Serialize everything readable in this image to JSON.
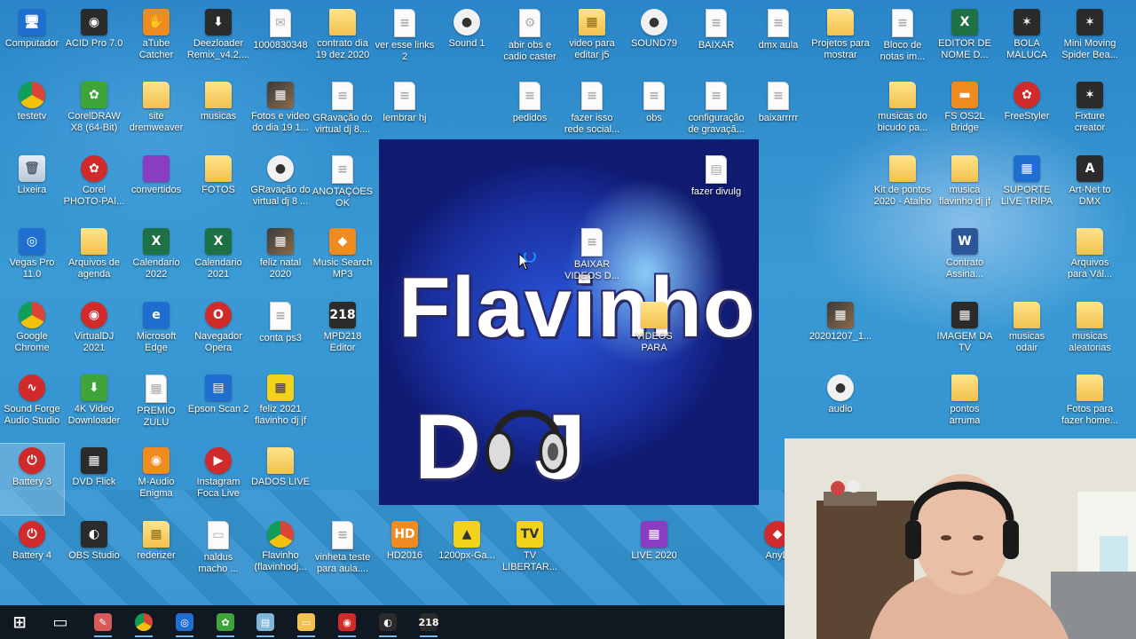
{
  "desktop": {
    "icons": [
      {
        "label": "Computador",
        "glyph": "🖥",
        "type": "blue"
      },
      {
        "label": "ACID Pro 7.0",
        "glyph": "◉",
        "type": "dark"
      },
      {
        "label": "aTube\nCatcher",
        "glyph": "✋",
        "type": "orange"
      },
      {
        "label": "Deezloader\nRemix_v4.2....",
        "glyph": "⬇",
        "type": "dark"
      },
      {
        "label": "1000830348",
        "glyph": "✉",
        "type": "file"
      },
      {
        "label": "contrato dia\n19 dez 2020",
        "glyph": "",
        "type": "folder"
      },
      {
        "label": "ver esse links\n2",
        "glyph": "≡",
        "type": "file"
      },
      {
        "label": "Sound 1",
        "glyph": "●",
        "type": "audio"
      },
      {
        "label": "abir obs e\ncadio caster",
        "glyph": "⚙",
        "type": "file"
      },
      {
        "label": "video para\neditar j5",
        "glyph": "▦",
        "type": "folder"
      },
      {
        "label": "SOUND79",
        "glyph": "●",
        "type": "audio"
      },
      {
        "label": "BAIXAR",
        "glyph": "≡",
        "type": "file"
      },
      {
        "label": "dmx aula",
        "glyph": "≡",
        "type": "file"
      },
      {
        "label": "Projetos para\nmostrar",
        "glyph": "",
        "type": "folder"
      },
      {
        "label": "Bloco de\nnotas im...",
        "glyph": "≡",
        "type": "file"
      },
      {
        "label": "EDITOR DE\nNOME D...",
        "glyph": "X",
        "type": "excel"
      },
      {
        "label": "BOLA\nMALUCA",
        "glyph": "✶",
        "type": "dark"
      },
      {
        "label": "Mini Moving\nSpider Bea...",
        "glyph": "✶",
        "type": "dark"
      },
      {
        "label": "testetv",
        "glyph": "",
        "type": "chrome"
      },
      {
        "label": "CorelDRAW\nX8 (64-Bit)",
        "glyph": "✿",
        "type": "green"
      },
      {
        "label": "site\ndremweaver",
        "glyph": "",
        "type": "folder"
      },
      {
        "label": "musicas",
        "glyph": "",
        "type": "folder"
      },
      {
        "label": "Fotos e video\ndo dia 19 1...",
        "glyph": "▦",
        "type": "img"
      },
      {
        "label": "GRavação do\nvirtual dj 8....",
        "glyph": "≡",
        "type": "file"
      },
      {
        "label": "lembrar hj",
        "glyph": "≡",
        "type": "file"
      },
      {
        "label": "pedidos",
        "glyph": "≡",
        "type": "file"
      },
      {
        "label": "fazer isso\nrede social...",
        "glyph": "≡",
        "type": "file"
      },
      {
        "label": "obs",
        "glyph": "≡",
        "type": "file"
      },
      {
        "label": "configuração\nde gravaçã...",
        "glyph": "≡",
        "type": "file"
      },
      {
        "label": "baixarrrrr",
        "glyph": "≡",
        "type": "file"
      },
      {
        "label": "musicas do\nbicudo pa...",
        "glyph": "",
        "type": "folder"
      },
      {
        "label": "FS OS2L\nBridge",
        "glyph": "▬",
        "type": "orange"
      },
      {
        "label": "FreeStyler",
        "glyph": "✿",
        "type": "red"
      },
      {
        "label": "Fixture\ncreator",
        "glyph": "✶",
        "type": "dark"
      },
      {
        "label": "Lixeira",
        "glyph": "🗑",
        "type": "bin"
      },
      {
        "label": "Corel\nPHOTO-PAI...",
        "glyph": "✿",
        "type": "red"
      },
      {
        "label": "convertidos",
        "glyph": "",
        "type": "purple"
      },
      {
        "label": "FOTOS",
        "glyph": "",
        "type": "folder"
      },
      {
        "label": "GRavação do\nvirtual dj 8 ...",
        "glyph": "●",
        "type": "audio"
      },
      {
        "label": "ANOTAÇÕES\nOK",
        "glyph": "≡",
        "type": "file"
      },
      {
        "label": "fazer divulg",
        "glyph": "▤",
        "type": "file"
      },
      {
        "label": "Kit de pontos\n2020 - Atalho",
        "glyph": "",
        "type": "folder"
      },
      {
        "label": "musica\nflavinho dj jf",
        "glyph": "",
        "type": "folder"
      },
      {
        "label": "SUPORTE\nLIVE TRIPA",
        "glyph": "▦",
        "type": "blue"
      },
      {
        "label": "Art-Net to\nDMX",
        "glyph": "A",
        "type": "dark"
      },
      {
        "label": "Vegas Pro\n11.0",
        "glyph": "◎",
        "type": "blue"
      },
      {
        "label": "Arquivos de\nagenda",
        "glyph": "",
        "type": "folder"
      },
      {
        "label": "Calendario\n2022",
        "glyph": "X",
        "type": "excel"
      },
      {
        "label": "Calendario\n2021",
        "glyph": "X",
        "type": "excel"
      },
      {
        "label": "feliz natal\n2020",
        "glyph": "▦",
        "type": "img"
      },
      {
        "label": "Music Search\nMP3",
        "glyph": "◆",
        "type": "orange"
      },
      {
        "label": "BAIXAR\nVIDEOS D...",
        "glyph": "≡",
        "type": "file"
      },
      {
        "label": "Contrato\nAssina...",
        "glyph": "W",
        "type": "word"
      },
      {
        "label": "Arquivos\npara Vál...",
        "glyph": "",
        "type": "folder"
      },
      {
        "label": "Google\nChrome",
        "glyph": "",
        "type": "chrome"
      },
      {
        "label": "VirtualDJ\n2021",
        "glyph": "◉",
        "type": "red"
      },
      {
        "label": "Microsoft\nEdge",
        "glyph": "e",
        "type": "blue"
      },
      {
        "label": "Navegador\nOpera",
        "glyph": "O",
        "type": "red"
      },
      {
        "label": "conta ps3",
        "glyph": "≡",
        "type": "file"
      },
      {
        "label": "MPD218\nEditor",
        "glyph": "218",
        "type": "dark"
      },
      {
        "label": "VIDEOS PARA\nUPAR - Atal...",
        "glyph": "",
        "type": "folder"
      },
      {
        "label": "20201207_1...",
        "glyph": "▦",
        "type": "img"
      },
      {
        "label": "IMAGEM DA\nTV LIBERATIA",
        "glyph": "▦",
        "type": "dark"
      },
      {
        "label": "musicas\nodair",
        "glyph": "",
        "type": "folder"
      },
      {
        "label": "musicas\naleatorias",
        "glyph": "",
        "type": "folder"
      },
      {
        "label": "Sound Forge\nAudio Studio",
        "glyph": "∿",
        "type": "red"
      },
      {
        "label": "4K Video\nDownloader",
        "glyph": "⬇",
        "type": "green"
      },
      {
        "label": "PREMIO\nZULU",
        "glyph": "▦",
        "type": "file"
      },
      {
        "label": "Epson Scan 2",
        "glyph": "▤",
        "type": "blue"
      },
      {
        "label": "feliz 2021\nflavinho dj jf",
        "glyph": "▦",
        "type": "yellow"
      },
      {
        "label": "audio",
        "glyph": "●",
        "type": "audio"
      },
      {
        "label": "pontos\narruma",
        "glyph": "",
        "type": "folder"
      },
      {
        "label": "Fotos para\nfazer home...",
        "glyph": "",
        "type": "folder"
      },
      {
        "label": "Battery 3",
        "glyph": "⏻",
        "type": "red"
      },
      {
        "label": "DVD Flick",
        "glyph": "▦",
        "type": "dark"
      },
      {
        "label": "M-Audio\nEnigma",
        "glyph": "◉",
        "type": "orange"
      },
      {
        "label": "Instagram\nFoca Live",
        "glyph": "▶",
        "type": "red"
      },
      {
        "label": "DADOS LIVE",
        "glyph": "",
        "type": "folder"
      },
      {
        "label": "Battery 4",
        "glyph": "⏻",
        "type": "red"
      },
      {
        "label": "OBS Studio",
        "glyph": "◐",
        "type": "dark"
      },
      {
        "label": "rederizer",
        "glyph": "▦",
        "type": "folder"
      },
      {
        "label": "naldus\nmacho ...",
        "glyph": "▭",
        "type": "file"
      },
      {
        "label": "Flavinho\n(flavinhodj...",
        "glyph": "",
        "type": "chrome"
      },
      {
        "label": "vinheta teste\npara aula....",
        "glyph": "≡",
        "type": "file"
      },
      {
        "label": "HD2016",
        "glyph": "HD",
        "type": "orange"
      },
      {
        "label": "1200px-Ga...",
        "glyph": "▲",
        "type": "yellow"
      },
      {
        "label": "TV\nLIBERTAR...",
        "glyph": "TV",
        "type": "yellow"
      },
      {
        "label": "LIVE 2020",
        "glyph": "▦",
        "type": "purple"
      },
      {
        "label": "AnyD",
        "glyph": "◆",
        "type": "red"
      }
    ]
  },
  "wallpaper_window": {
    "title_line1": "Flavinho",
    "title_line2": "DJ  JF"
  },
  "taskbar": {
    "items": [
      {
        "name": "start",
        "glyph": "⊞",
        "color": "#101822"
      },
      {
        "name": "task-view",
        "glyph": "▭",
        "color": "#101822"
      },
      {
        "name": "paint",
        "glyph": "✎",
        "color": "#d65a5a"
      },
      {
        "name": "chrome",
        "glyph": "",
        "color": "chrome"
      },
      {
        "name": "vegas",
        "glyph": "◎",
        "color": "#1f6fd1"
      },
      {
        "name": "coreldraw",
        "glyph": "✿",
        "color": "#3fa53b"
      },
      {
        "name": "notepad",
        "glyph": "▤",
        "color": "#7fb6d9"
      },
      {
        "name": "file-explorer",
        "glyph": "▭",
        "color": "#f2c14e"
      },
      {
        "name": "virtualdj",
        "glyph": "◉",
        "color": "#d12a2a"
      },
      {
        "name": "obs",
        "glyph": "◐",
        "color": "#2b2b2b"
      },
      {
        "name": "mpd218",
        "glyph": "218",
        "color": "#2b2b2b"
      }
    ]
  }
}
